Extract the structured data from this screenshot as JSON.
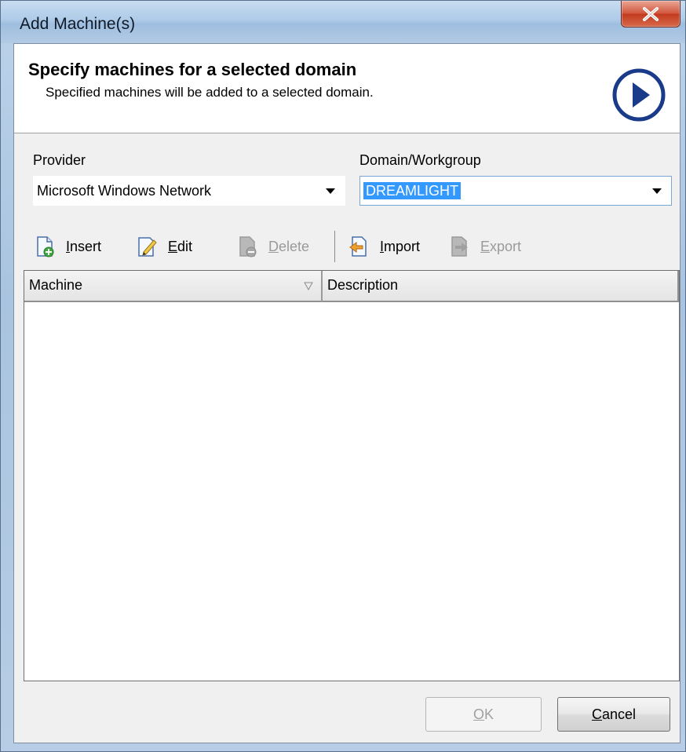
{
  "window": {
    "title": "Add Machine(s)",
    "close_glyph": "X"
  },
  "header": {
    "title": "Specify machines for a selected domain",
    "subtitle": "Specified machines will be added to a selected domain.",
    "icon": "next-arrow-icon",
    "icon_color": "#1a3a8a"
  },
  "form": {
    "provider_label": "Provider",
    "provider_value": "Microsoft Windows Network",
    "domain_label": "Domain/Workgroup",
    "domain_value": "DREAMLIGHT"
  },
  "toolbar": {
    "insert_label": "Insert",
    "insert_mnemonic": "I",
    "insert_rest": "nsert",
    "edit_mnemonic": "E",
    "edit_rest": "dit",
    "delete_mnemonic": "D",
    "delete_rest": "elete",
    "import_mnemonic": "I",
    "import_rest": "mport",
    "export_mnemonic": "E",
    "export_rest": "xport"
  },
  "grid": {
    "columns": [
      "Machine",
      "Description"
    ],
    "sort_glyph": "▽",
    "rows": []
  },
  "buttons": {
    "ok_mnemonic": "O",
    "ok_rest": "K",
    "cancel_mnemonic": "C",
    "cancel_rest": "ancel"
  },
  "colors": {
    "selection": "#3399ff",
    "disabled_text": "#9a9a9a",
    "close_button": "#c23a1f"
  }
}
